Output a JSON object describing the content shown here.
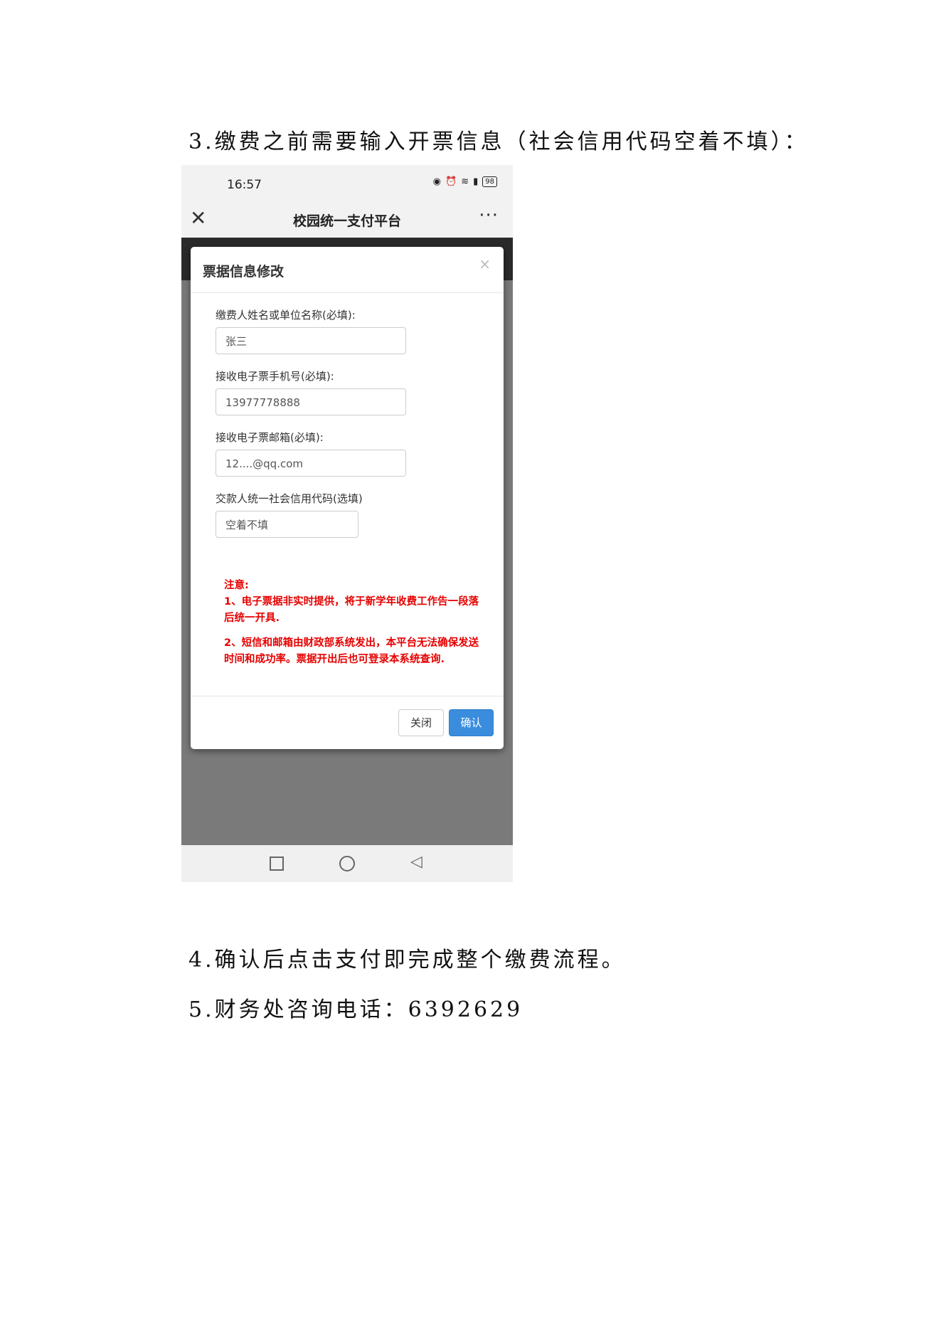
{
  "document": {
    "line3": "3.缴费之前需要输入开票信息（社会信用代码空着不填）：",
    "line4": "4.确认后点击支付即完成整个缴费流程。",
    "line5": "5.财务处咨询电话：6392629"
  },
  "phone": {
    "status_time": "16:57",
    "battery_level": "98",
    "icons": [
      "eye-icon",
      "alarm-icon",
      "wifi-icon",
      "signal-icon",
      "battery-icon"
    ],
    "title": "校园统一支付平台",
    "close_glyph": "✕",
    "more_glyph": "···"
  },
  "modal": {
    "title": "票据信息修改",
    "close_glyph": "×",
    "fields": [
      {
        "label": "缴费人姓名或单位名称(必填):",
        "value": "张三"
      },
      {
        "label": "接收电子票手机号(必填):",
        "value": "13977778888"
      },
      {
        "label": "接收电子票邮箱(必填):",
        "value": "12....@qq.com"
      },
      {
        "label": "交款人统一社会信用代码(选填)",
        "value": "空着不填"
      }
    ],
    "notice": {
      "heading": "注意:",
      "item1": "1、电子票据非实时提供，将于新学年收费工作告一段落后统一开具.",
      "item2": "2、短信和邮箱由财政部系统发出，本平台无法确保发送时间和成功率。票据开出后也可登录本系统查询."
    },
    "close_button": "关闭",
    "confirm_button": "确认"
  },
  "colors": {
    "notice_red": "#e60000",
    "confirm_blue": "#3a8ddd",
    "overlay_gray": "#7a7a7a"
  }
}
